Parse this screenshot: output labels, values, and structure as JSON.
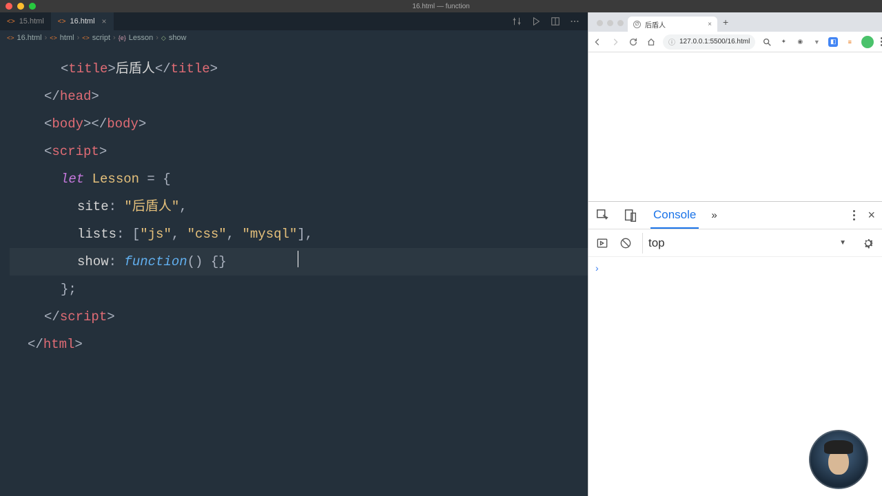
{
  "window": {
    "title": "16.html — function"
  },
  "editor": {
    "tabs": [
      {
        "label": "15.html",
        "active": false
      },
      {
        "label": "16.html",
        "active": true
      }
    ],
    "crumbs": [
      "16.html",
      "html",
      "script",
      "Lesson",
      "show"
    ],
    "code": {
      "title_open": "<",
      "title_tag": "title",
      "title_gt": ">",
      "title_text": "后盾人",
      "title_close_open": "</",
      "title_close_gt": ">",
      "head_close_open": "</",
      "head_tag": "head",
      "head_close_gt": ">",
      "body_open": "<",
      "body_tag": "body",
      "body_gt": "></",
      "body_close_gt": ">",
      "script_open": "<",
      "script_tag": "script",
      "script_gt": ">",
      "let": "let ",
      "lesson": "Lesson",
      "eq": " = {",
      "site_key": "site",
      "site_colon": ": ",
      "site_val": "\"后盾人\"",
      "site_comma": ",",
      "lists_key": "lists",
      "lists_colon": ": [",
      "lists_v1": "\"js\"",
      "lc1": ", ",
      "lists_v2": "\"css\"",
      "lc2": ", ",
      "lists_v3": "\"mysql\"",
      "lists_close": "],",
      "show_key": "show",
      "show_colon": ": ",
      "show_fn": "function",
      "show_paren": "()",
      "show_body": " {}",
      "obj_close": "};",
      "script_close_open": "</",
      "script_close_gt": ">",
      "html_close_open": "</",
      "html_tag": "html",
      "html_close_gt": ">"
    }
  },
  "browser": {
    "tab": {
      "title": "后盾人"
    },
    "url": "127.0.0.1:5500/16.html",
    "devtools": {
      "active_tab": "Console",
      "context": "top"
    }
  }
}
